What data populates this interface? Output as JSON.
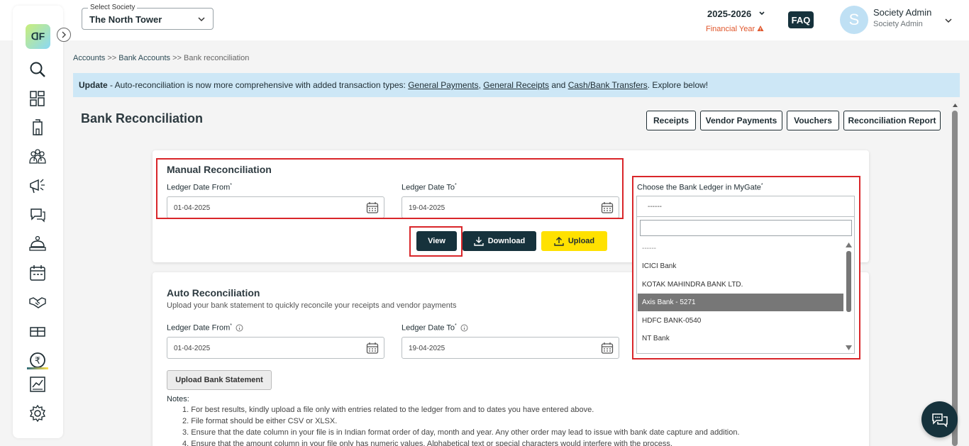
{
  "logo": {
    "text": "ᗡF"
  },
  "header": {
    "society_label": "Select Society",
    "society_value": "The North Tower",
    "financial_year": "2025-2026",
    "financial_year_label": "Financial Year",
    "faq": "FAQ",
    "avatar_letter": "S",
    "user_name": "Society Admin",
    "user_role": "Society Admin"
  },
  "sidebar": {
    "items": [
      "search-icon",
      "dashboard-icon",
      "building-icon",
      "residents-icon",
      "announcements-icon",
      "chat-icon",
      "helpdesk-icon",
      "calendar-icon",
      "handshake-icon",
      "amenities-icon",
      "accounts-icon",
      "reports-icon",
      "settings-icon"
    ],
    "active": "accounts-icon"
  },
  "breadcrumb": {
    "items": [
      "Accounts",
      "Bank Accounts",
      "Bank reconciliation"
    ],
    "separator": ">>"
  },
  "banner": {
    "prefix": "Update",
    "text": " - Auto-reconciliation is now more comprehensive with added transaction types: ",
    "link1": "General Payments",
    "sep": ", ",
    "link2": "General Receipts",
    "and": " and ",
    "link3": "Cash/Bank Transfers",
    "suffix": ". Explore below!"
  },
  "page": {
    "title": "Bank Reconciliation",
    "buttons": [
      "Receipts",
      "Vendor Payments",
      "Vouchers",
      "Reconciliation Report"
    ]
  },
  "manual": {
    "title": "Manual Reconciliation",
    "from_label": "Ledger Date From",
    "from_value": "01-04-2025",
    "to_label": "Ledger Date To",
    "to_value": "19-04-2025",
    "view": "View",
    "download": "Download",
    "upload": "Upload"
  },
  "bank_ledger": {
    "label": "Choose the Bank Ledger in MyGate",
    "selected": "------",
    "search_value": "",
    "options": [
      "------",
      "ICICI Bank",
      "KOTAK MAHINDRA BANK LTD.",
      "Axis Bank - 5271",
      "HDFC BANK-0540",
      "NT Bank"
    ],
    "highlighted": "Axis Bank - 5271"
  },
  "auto": {
    "title": "Auto Reconciliation",
    "description": "Upload your bank statement to quickly reconcile your receipts and vendor payments",
    "from_label": "Ledger Date From",
    "from_value": "01-04-2025",
    "to_label": "Ledger Date To",
    "to_value": "19-04-2025",
    "upload_statement": "Upload Bank Statement",
    "notes_title": "Notes:",
    "notes": [
      "1. For best results, kindly upload a file only with entries related to the ledger from and to dates you have entered above.",
      "2. File format should be either CSV or XLSX.",
      "3. Ensure that the date column in your file is in Indian format order of day, month and year. Any other order may lead to issue with bank date capture and addition.",
      "4. Ensure that the amount column in your file only has numeric values. Alphabetical text or special characters would interfere with the process."
    ]
  },
  "colors": {
    "primary": "#16323c",
    "accent_yellow": "#ffe100",
    "highlight_red": "#d9262a",
    "banner_bg": "#cde7f6",
    "warning": "#e0562b"
  }
}
